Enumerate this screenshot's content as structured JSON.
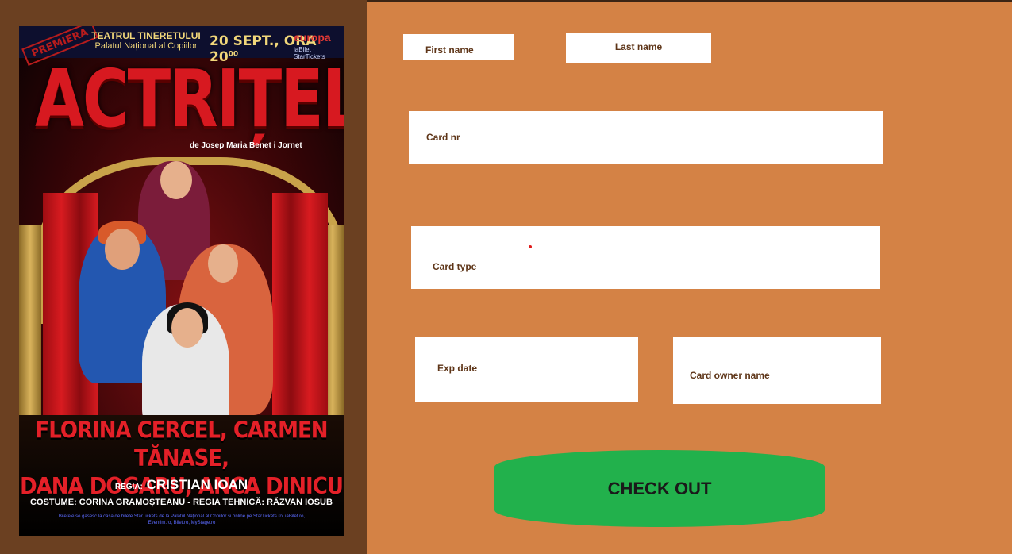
{
  "poster": {
    "premiere_tag": "PREMIERA",
    "theater_name": "TEATRUL TINERETULUI",
    "theater_venue": "Palatul Național al Copiilor",
    "date_time": "20 SEPT., ORA 20",
    "date_time_sup": "00",
    "sponsor": "europa",
    "ticketing": "iaBilet · StarTickets",
    "title": "ACTRIȚELE",
    "author": "de Josep Maria Benet i Jornet",
    "cast_line1": "FLORINA CERCEL, CARMEN TĂNASE,",
    "cast_line2": "DANA DOGARU, ANCA DINICU",
    "director_label": "REGIA:",
    "director": "CRISTIAN IOAN",
    "credits": "COSTUME: CORINA GRAMOȘTEANU - REGIA TEHNICĂ: RĂZVAN IOSUB",
    "fine_print": "Biletele se găsesc la casa de bilete StarTickets de la Palatul Național al Copiilor și online pe StarTickets.ro, iaBilet.ro, Eventim.ro, Bilet.ro, MyStage.ro"
  },
  "form": {
    "first_name_label": "First name",
    "last_name_label": "Last name",
    "card_nr_label": "Card nr",
    "card_type_label": "Card type",
    "exp_date_label": "Exp date",
    "card_owner_label": "Card owner name",
    "checkout_label": "CHECK OUT"
  },
  "colors": {
    "page_background": "#6b4021",
    "form_background": "#d48245",
    "field_background": "#ffffff",
    "label_text": "#5e3518",
    "checkout_button": "#22b14c"
  }
}
